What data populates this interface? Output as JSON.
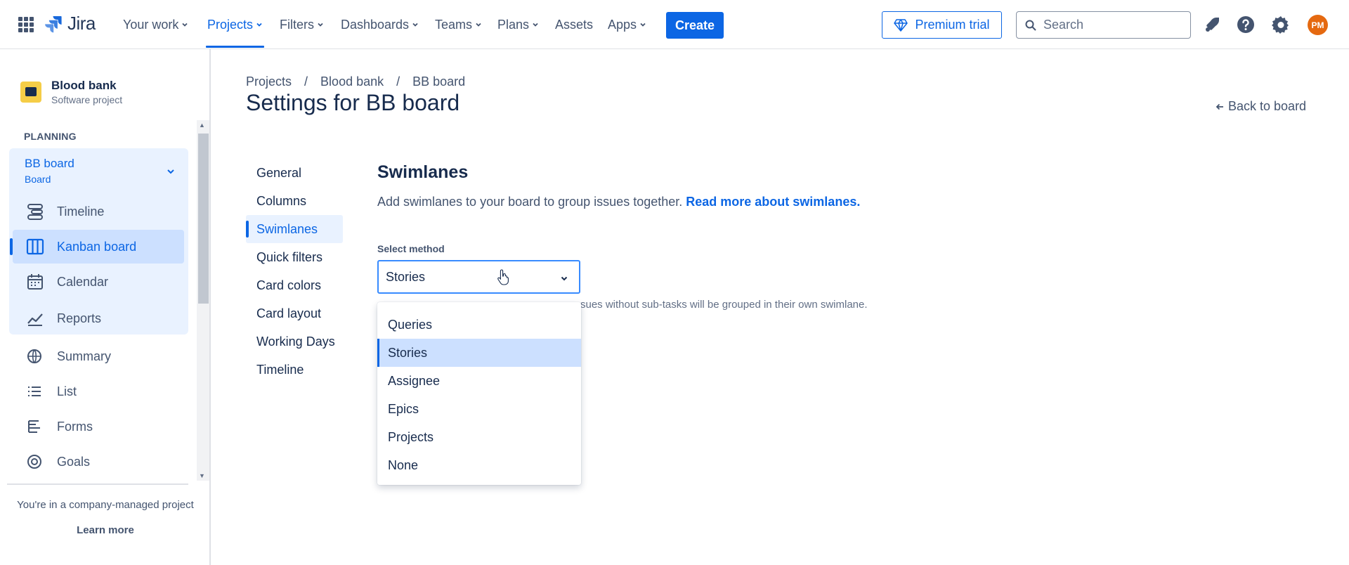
{
  "topnav": {
    "logo_text": "Jira",
    "items": [
      {
        "label": "Your work"
      },
      {
        "label": "Projects"
      },
      {
        "label": "Filters"
      },
      {
        "label": "Dashboards"
      },
      {
        "label": "Teams"
      },
      {
        "label": "Plans"
      },
      {
        "label": "Assets"
      },
      {
        "label": "Apps"
      }
    ],
    "create_label": "Create",
    "premium_label": "Premium trial",
    "search_placeholder": "Search",
    "avatar_initials": "PM",
    "accent": "#0c66e4"
  },
  "sidebar": {
    "project_name": "Blood bank",
    "project_type": "Software project",
    "planning_label": "PLANNING",
    "board_name": "BB board",
    "board_type": "Board",
    "board_items": [
      {
        "label": "Timeline",
        "icon": "timeline-icon"
      },
      {
        "label": "Kanban board",
        "icon": "board-icon"
      },
      {
        "label": "Calendar",
        "icon": "calendar-icon"
      },
      {
        "label": "Reports",
        "icon": "reports-icon"
      }
    ],
    "other_items": [
      {
        "label": "Summary",
        "icon": "globe-icon"
      },
      {
        "label": "List",
        "icon": "list-icon"
      },
      {
        "label": "Forms",
        "icon": "forms-icon"
      },
      {
        "label": "Goals",
        "icon": "goals-icon"
      }
    ],
    "managed_text": "You're in a company-managed project",
    "learn_more": "Learn more"
  },
  "main": {
    "breadcrumbs": [
      "Projects",
      "Blood bank",
      "BB board"
    ],
    "breadcrumb_sep": "/",
    "title": "Settings for BB board",
    "back_label": "Back to board",
    "settings_nav": [
      "General",
      "Columns",
      "Swimlanes",
      "Quick filters",
      "Card colors",
      "Card layout",
      "Working Days",
      "Timeline"
    ],
    "section_title": "Swimlanes",
    "section_desc": "Add swimlanes to your board to group issues together.",
    "section_link": "Read more about swimlanes",
    "field_label": "Select method",
    "selected_value": "Stories",
    "help_text": "sues without sub-tasks will be grouped in their own swimlane.",
    "options": [
      "Queries",
      "Stories",
      "Assignee",
      "Epics",
      "Projects",
      "None"
    ]
  }
}
